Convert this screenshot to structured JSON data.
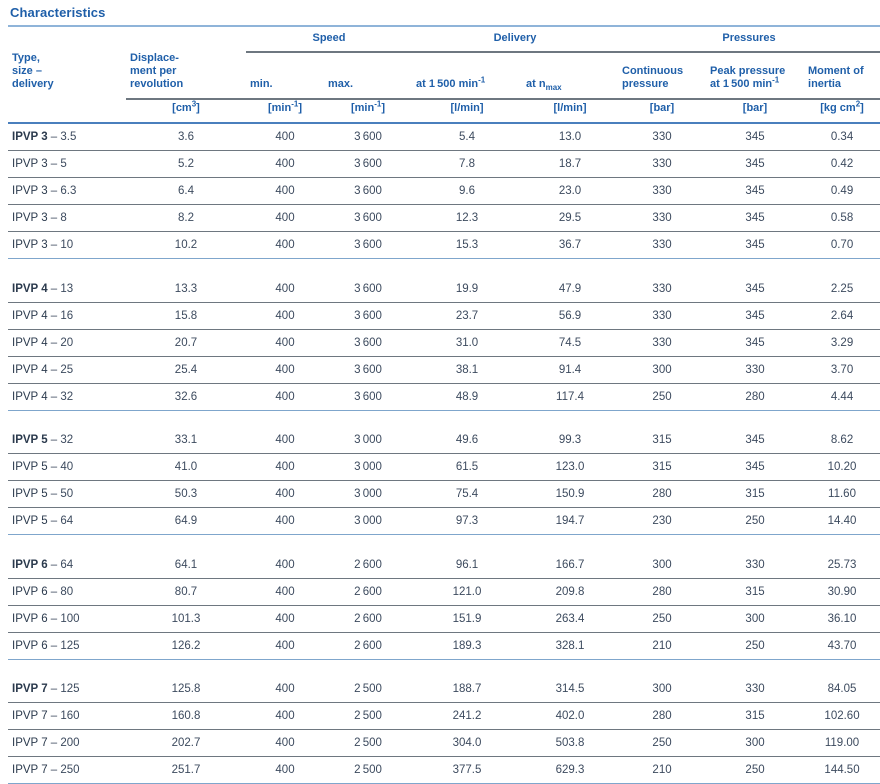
{
  "title": "Characteristics",
  "header": {
    "type_label_lines": [
      "Type,",
      "size –",
      "delivery"
    ],
    "displacement_lines": [
      "Displace-",
      "ment per",
      "revolution"
    ],
    "groups": {
      "speed": "Speed",
      "delivery": "Delivery",
      "pressures": "Pressures"
    },
    "sub": {
      "speed_min": "min.",
      "speed_max": "max.",
      "delivery_1500_pre": "at 1 500 min",
      "delivery_1500_sup": "-1",
      "delivery_nmax_pre": "at n",
      "delivery_nmax_sub": "max",
      "continuous_line1": "Continuous",
      "continuous_line2": "pressure",
      "peak_line1": "Peak pressure",
      "peak_line2_pre": "at 1 500 min",
      "peak_line2_sup": "-1",
      "moi_line1": "Moment of",
      "moi_line2": "inertia"
    },
    "units": {
      "displacement_pre": "[cm",
      "displacement_sup": "3",
      "displacement_post": "]",
      "speed_min_pre": "[min",
      "speed_min_sup": "-1",
      "speed_min_post": "]",
      "speed_max_pre": "[min",
      "speed_max_sup": "-1",
      "speed_max_post": "]",
      "delivery_1500": "[l/min]",
      "delivery_nmax": "[l/min]",
      "continuous": "[bar]",
      "peak": "[bar]",
      "moi_pre": "[kg cm",
      "moi_sup": "2",
      "moi_post": "]"
    }
  },
  "colors": {
    "accent_blue": "#1f5fa9",
    "rule_blue": "#7fa6cc",
    "rule_gray": "#6e7780",
    "text": "#3c4a5e",
    "title_rule": "#8fb4d9"
  },
  "chart_data": {
    "type": "table",
    "title": "Characteristics",
    "columns": [
      "Type, size – delivery",
      "Displacement per revolution [cm³]",
      "Speed min. [min⁻¹]",
      "Speed max. [min⁻¹]",
      "Delivery at 1500 min⁻¹ [l/min]",
      "Delivery at n_max [l/min]",
      "Continuous pressure [bar]",
      "Peak pressure at 1500 min⁻¹ [bar]",
      "Moment of inertia [kg cm²]"
    ],
    "groups": [
      {
        "series": "IPVP 3",
        "rows": [
          {
            "model": "IPVP 3",
            "size": "– 3.5",
            "displacement": "3.6",
            "speed_min": "400",
            "speed_max": "3 600",
            "delivery_1500": "5.4",
            "delivery_nmax": "13.0",
            "continuous": "330",
            "peak": "345",
            "moi": "0.34"
          },
          {
            "model": "IPVP 3",
            "size": "– 5",
            "displacement": "5.2",
            "speed_min": "400",
            "speed_max": "3 600",
            "delivery_1500": "7.8",
            "delivery_nmax": "18.7",
            "continuous": "330",
            "peak": "345",
            "moi": "0.42"
          },
          {
            "model": "IPVP 3",
            "size": "– 6.3",
            "displacement": "6.4",
            "speed_min": "400",
            "speed_max": "3 600",
            "delivery_1500": "9.6",
            "delivery_nmax": "23.0",
            "continuous": "330",
            "peak": "345",
            "moi": "0.49"
          },
          {
            "model": "IPVP 3",
            "size": "– 8",
            "displacement": "8.2",
            "speed_min": "400",
            "speed_max": "3 600",
            "delivery_1500": "12.3",
            "delivery_nmax": "29.5",
            "continuous": "330",
            "peak": "345",
            "moi": "0.58"
          },
          {
            "model": "IPVP 3",
            "size": "– 10",
            "displacement": "10.2",
            "speed_min": "400",
            "speed_max": "3 600",
            "delivery_1500": "15.3",
            "delivery_nmax": "36.7",
            "continuous": "330",
            "peak": "345",
            "moi": "0.70"
          }
        ]
      },
      {
        "series": "IPVP 4",
        "rows": [
          {
            "model": "IPVP 4",
            "size": "– 13",
            "displacement": "13.3",
            "speed_min": "400",
            "speed_max": "3 600",
            "delivery_1500": "19.9",
            "delivery_nmax": "47.9",
            "continuous": "330",
            "peak": "345",
            "moi": "2.25"
          },
          {
            "model": "IPVP 4",
            "size": "– 16",
            "displacement": "15.8",
            "speed_min": "400",
            "speed_max": "3 600",
            "delivery_1500": "23.7",
            "delivery_nmax": "56.9",
            "continuous": "330",
            "peak": "345",
            "moi": "2.64"
          },
          {
            "model": "IPVP 4",
            "size": "– 20",
            "displacement": "20.7",
            "speed_min": "400",
            "speed_max": "3 600",
            "delivery_1500": "31.0",
            "delivery_nmax": "74.5",
            "continuous": "330",
            "peak": "345",
            "moi": "3.29"
          },
          {
            "model": "IPVP 4",
            "size": "– 25",
            "displacement": "25.4",
            "speed_min": "400",
            "speed_max": "3 600",
            "delivery_1500": "38.1",
            "delivery_nmax": "91.4",
            "continuous": "300",
            "peak": "330",
            "moi": "3.70"
          },
          {
            "model": "IPVP 4",
            "size": "– 32",
            "displacement": "32.6",
            "speed_min": "400",
            "speed_max": "3 600",
            "delivery_1500": "48.9",
            "delivery_nmax": "117.4",
            "continuous": "250",
            "peak": "280",
            "moi": "4.44"
          }
        ]
      },
      {
        "series": "IPVP 5",
        "rows": [
          {
            "model": "IPVP 5",
            "size": "– 32",
            "displacement": "33.1",
            "speed_min": "400",
            "speed_max": "3 000",
            "delivery_1500": "49.6",
            "delivery_nmax": "99.3",
            "continuous": "315",
            "peak": "345",
            "moi": "8.62"
          },
          {
            "model": "IPVP 5",
            "size": "– 40",
            "displacement": "41.0",
            "speed_min": "400",
            "speed_max": "3 000",
            "delivery_1500": "61.5",
            "delivery_nmax": "123.0",
            "continuous": "315",
            "peak": "345",
            "moi": "10.20"
          },
          {
            "model": "IPVP 5",
            "size": "– 50",
            "displacement": "50.3",
            "speed_min": "400",
            "speed_max": "3 000",
            "delivery_1500": "75.4",
            "delivery_nmax": "150.9",
            "continuous": "280",
            "peak": "315",
            "moi": "11.60"
          },
          {
            "model": "IPVP 5",
            "size": "– 64",
            "displacement": "64.9",
            "speed_min": "400",
            "speed_max": "3 000",
            "delivery_1500": "97.3",
            "delivery_nmax": "194.7",
            "continuous": "230",
            "peak": "250",
            "moi": "14.40"
          }
        ]
      },
      {
        "series": "IPVP 6",
        "rows": [
          {
            "model": "IPVP 6",
            "size": "– 64",
            "displacement": "64.1",
            "speed_min": "400",
            "speed_max": "2 600",
            "delivery_1500": "96.1",
            "delivery_nmax": "166.7",
            "continuous": "300",
            "peak": "330",
            "moi": "25.73"
          },
          {
            "model": "IPVP 6",
            "size": "– 80",
            "displacement": "80.7",
            "speed_min": "400",
            "speed_max": "2 600",
            "delivery_1500": "121.0",
            "delivery_nmax": "209.8",
            "continuous": "280",
            "peak": "315",
            "moi": "30.90"
          },
          {
            "model": "IPVP 6",
            "size": "– 100",
            "displacement": "101.3",
            "speed_min": "400",
            "speed_max": "2 600",
            "delivery_1500": "151.9",
            "delivery_nmax": "263.4",
            "continuous": "250",
            "peak": "300",
            "moi": "36.10"
          },
          {
            "model": "IPVP 6",
            "size": "– 125",
            "displacement": "126.2",
            "speed_min": "400",
            "speed_max": "2 600",
            "delivery_1500": "189.3",
            "delivery_nmax": "328.1",
            "continuous": "210",
            "peak": "250",
            "moi": "43.70"
          }
        ]
      },
      {
        "series": "IPVP 7",
        "rows": [
          {
            "model": "IPVP 7",
            "size": "– 125",
            "displacement": "125.8",
            "speed_min": "400",
            "speed_max": "2 500",
            "delivery_1500": "188.7",
            "delivery_nmax": "314.5",
            "continuous": "300",
            "peak": "330",
            "moi": "84.05"
          },
          {
            "model": "IPVP 7",
            "size": "– 160",
            "displacement": "160.8",
            "speed_min": "400",
            "speed_max": "2 500",
            "delivery_1500": "241.2",
            "delivery_nmax": "402.0",
            "continuous": "280",
            "peak": "315",
            "moi": "102.60"
          },
          {
            "model": "IPVP 7",
            "size": "– 200",
            "displacement": "202.7",
            "speed_min": "400",
            "speed_max": "2 500",
            "delivery_1500": "304.0",
            "delivery_nmax": "503.8",
            "continuous": "250",
            "peak": "300",
            "moi": "119.00"
          },
          {
            "model": "IPVP 7",
            "size": "– 250",
            "displacement": "251.7",
            "speed_min": "400",
            "speed_max": "2 500",
            "delivery_1500": "377.5",
            "delivery_nmax": "629.3",
            "continuous": "210",
            "peak": "250",
            "moi": "144.50"
          }
        ]
      }
    ]
  }
}
